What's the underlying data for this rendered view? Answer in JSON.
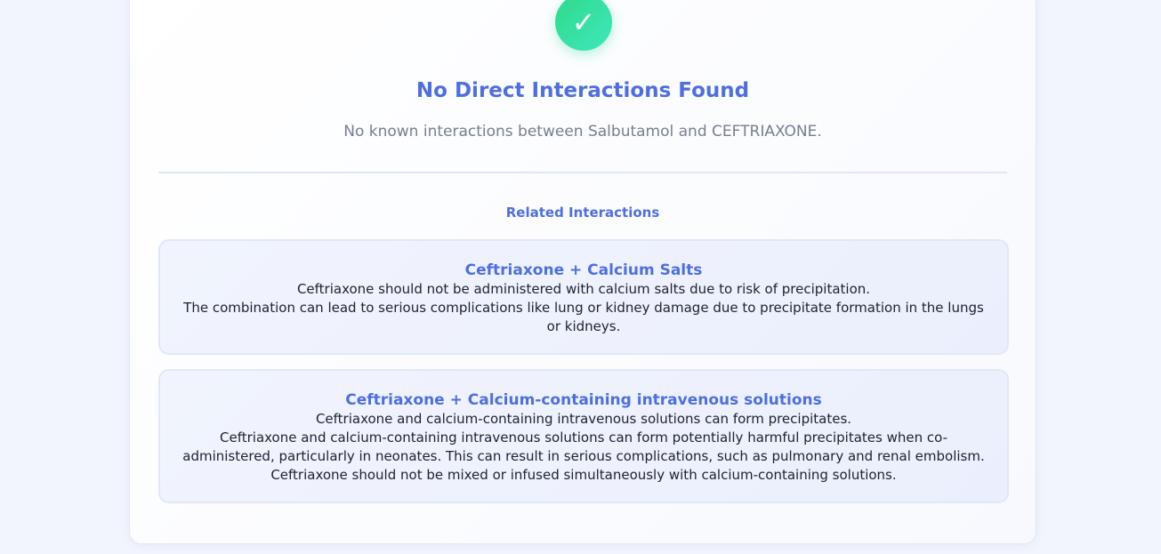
{
  "result": {
    "icon": "check-icon",
    "icon_glyph": "✓",
    "title": "No Direct Interactions Found",
    "message": "No known interactions between Salbutamol and CEFTRIAXONE."
  },
  "related": {
    "heading": "Related Interactions",
    "items": [
      {
        "title": "Ceftriaxone + Calcium Salts",
        "summary": "Ceftriaxone should not be administered with calcium salts due to risk of precipitation.",
        "detail": "The combination can lead to serious complications like lung or kidney damage due to precipitate formation in the lungs or kidneys."
      },
      {
        "title": "Ceftriaxone + Calcium-containing intravenous solutions",
        "summary": "Ceftriaxone and calcium-containing intravenous solutions can form precipitates.",
        "detail": "Ceftriaxone and calcium-containing intravenous solutions can form potentially harmful precipitates when co-administered, particularly in neonates. This can result in serious complications, such as pulmonary and renal embolism. Ceftriaxone should not be mixed or infused simultaneously with calcium-containing solutions."
      }
    ]
  },
  "colors": {
    "accent": "#4f6fe0",
    "success": "#2fd98a"
  }
}
